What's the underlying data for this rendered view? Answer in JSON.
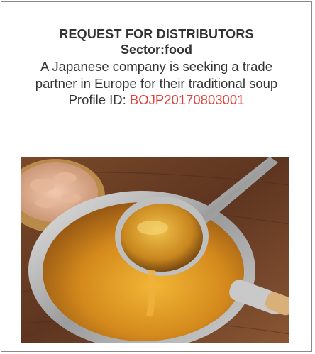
{
  "listing": {
    "title": "REQUEST FOR DISTRIBUTORS",
    "sector": "Sector:food",
    "description_line1": "A Japanese company is seeking a trade",
    "description_line2": "partner in Europe for their traditional soup",
    "profile_label": "Profile ID: ",
    "profile_id": "BOJP20170803001"
  },
  "colors": {
    "text": "#333333",
    "profile_id": "#e0403a",
    "border": "#8a8a8a"
  },
  "image": {
    "description": "ladle-in-pot-photo"
  }
}
